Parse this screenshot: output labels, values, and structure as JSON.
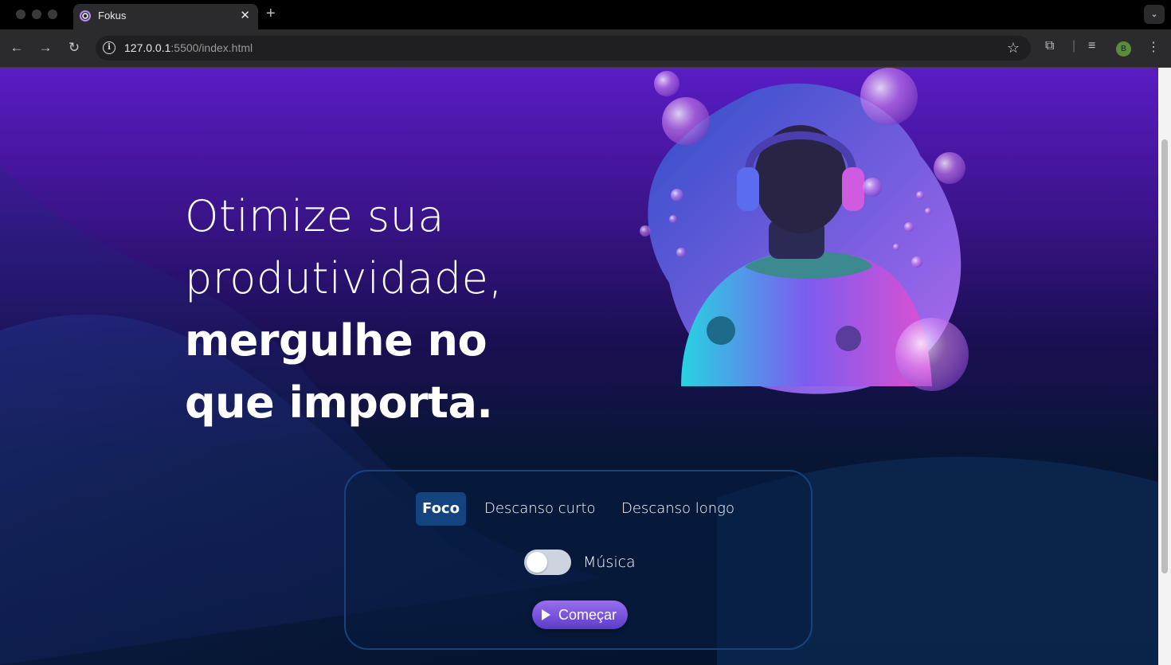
{
  "browser": {
    "tab_title": "Fokus",
    "tab_close": "✕",
    "new_tab": "+",
    "url_host": "127.0.0.1",
    "url_rest": ":5500/index.html",
    "avatar_letter": "B",
    "avatar_color": "#5b8c3a",
    "icons": [
      "back-icon",
      "forward-icon",
      "reload-icon",
      "info-icon",
      "bookmark-star-icon",
      "extensions-icon",
      "media-queue-icon",
      "more-menu-icon",
      "tab-list-icon"
    ]
  },
  "hero": {
    "line1": "Otimize sua",
    "line2": "produtividade,",
    "line3": "mergulhe no",
    "line4": "que importa.",
    "image": "person-with-headphones-and-bubbles-illustration"
  },
  "timer_card": {
    "modes": [
      {
        "label": "Foco",
        "active": true
      },
      {
        "label": "Descanso curto",
        "active": false
      },
      {
        "label": "Descanso longo",
        "active": false
      }
    ],
    "music_label": "Música",
    "music_on": false,
    "start_label": "Começar"
  },
  "colors": {
    "active_mode": "#144480",
    "card_border": "#144480",
    "bg_top": "#5a1cc4",
    "bg_bottom": "#04142c"
  }
}
